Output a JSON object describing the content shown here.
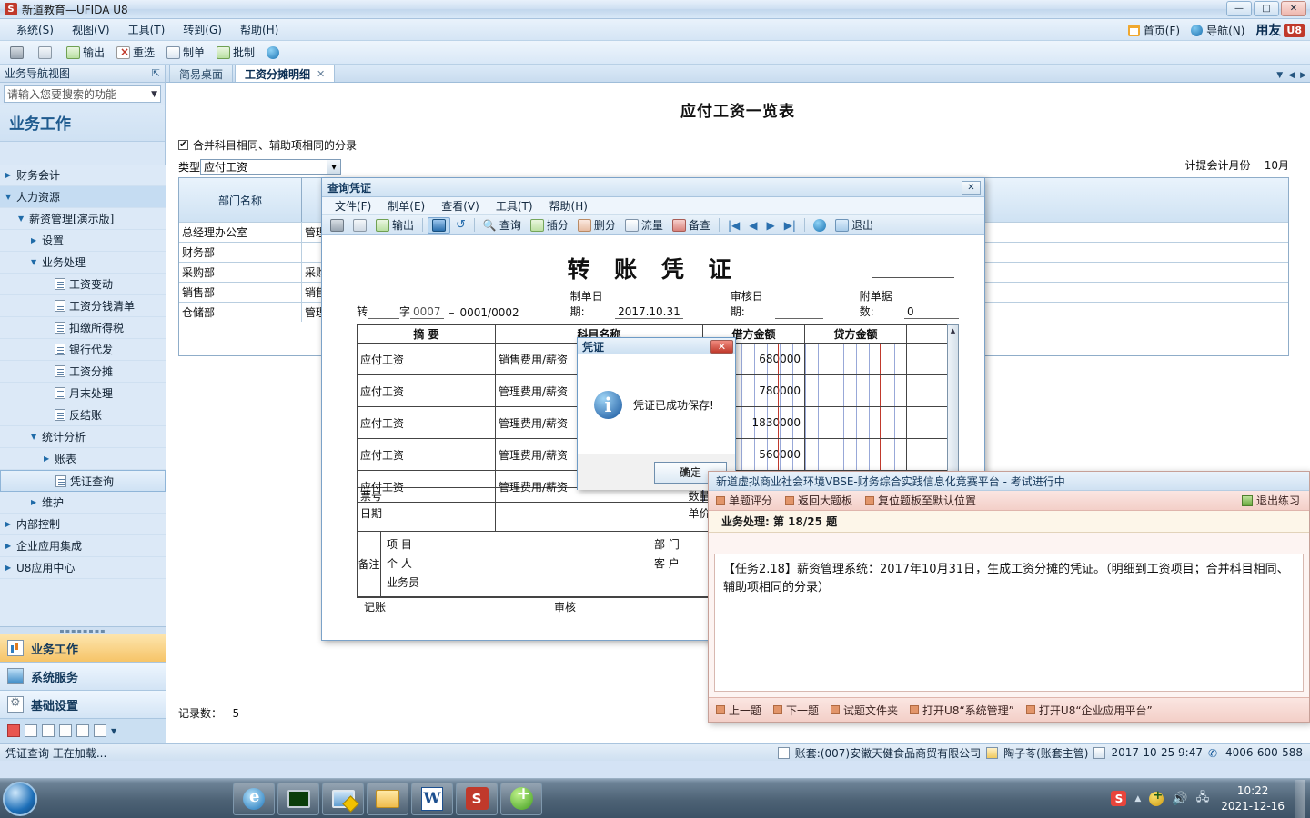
{
  "window": {
    "title": "新道教育—UFIDA U8",
    "logo_text": "S",
    "buttons": {
      "minimize": "—",
      "maximize": "□",
      "close": "✕"
    }
  },
  "menubar": {
    "items": [
      "系统(S)",
      "视图(V)",
      "工具(T)",
      "转到(G)",
      "帮助(H)"
    ],
    "right": {
      "home": "首页(F)",
      "nav": "导航(N)",
      "brand": "用友",
      "brand_mark": "U8"
    }
  },
  "toolbar": {
    "items": [
      {
        "label": "",
        "icon": "print-icon"
      },
      {
        "label": "",
        "icon": "preview-icon"
      },
      {
        "label": "输出",
        "icon": "export-icon"
      },
      {
        "label": "重选",
        "icon": "reselect-icon"
      },
      {
        "label": "制单",
        "icon": "voucher-icon"
      },
      {
        "label": "批制",
        "icon": "batch-icon"
      },
      {
        "label": "",
        "icon": "help-icon"
      }
    ]
  },
  "sidebar": {
    "header": "业务导航视图",
    "pin": "⇱",
    "search_placeholder": "请输入您要搜索的功能",
    "title": "业务工作",
    "tree": [
      {
        "label": "财务会计",
        "indent": 0,
        "arrow": "right",
        "type": "folder"
      },
      {
        "label": "人力资源",
        "indent": 0,
        "arrow": "down",
        "type": "folder",
        "highlight": true
      },
      {
        "label": "薪资管理[演示版]",
        "indent": 1,
        "arrow": "down",
        "type": "folder"
      },
      {
        "label": "设置",
        "indent": 2,
        "arrow": "right",
        "type": "folder"
      },
      {
        "label": "业务处理",
        "indent": 2,
        "arrow": "down",
        "type": "folder"
      },
      {
        "label": "工资变动",
        "indent": 3,
        "arrow": "none",
        "type": "doc"
      },
      {
        "label": "工资分钱清单",
        "indent": 3,
        "arrow": "none",
        "type": "doc"
      },
      {
        "label": "扣缴所得税",
        "indent": 3,
        "arrow": "none",
        "type": "doc"
      },
      {
        "label": "银行代发",
        "indent": 3,
        "arrow": "none",
        "type": "doc"
      },
      {
        "label": "工资分摊",
        "indent": 3,
        "arrow": "none",
        "type": "doc"
      },
      {
        "label": "月末处理",
        "indent": 3,
        "arrow": "none",
        "type": "doc"
      },
      {
        "label": "反结账",
        "indent": 3,
        "arrow": "none",
        "type": "doc"
      },
      {
        "label": "统计分析",
        "indent": 2,
        "arrow": "down",
        "type": "folder"
      },
      {
        "label": "账表",
        "indent": 3,
        "arrow": "right",
        "type": "folder"
      },
      {
        "label": "凭证查询",
        "indent": 3,
        "arrow": "none",
        "type": "doc",
        "selected": true
      },
      {
        "label": "维护",
        "indent": 2,
        "arrow": "right",
        "type": "folder"
      },
      {
        "label": "内部控制",
        "indent": 0,
        "arrow": "right",
        "type": "folder"
      },
      {
        "label": "企业应用集成",
        "indent": 0,
        "arrow": "right",
        "type": "folder"
      },
      {
        "label": "U8应用中心",
        "indent": 0,
        "arrow": "right",
        "type": "folder"
      }
    ],
    "bottom_buttons": [
      {
        "label": "业务工作",
        "icon": "chart-icon",
        "active": true
      },
      {
        "label": "系统服务",
        "icon": "monitor-icon",
        "active": false
      },
      {
        "label": "基础设置",
        "icon": "gear-icon",
        "active": false
      }
    ]
  },
  "tabs": [
    {
      "label": "简易桌面",
      "active": false,
      "closable": false
    },
    {
      "label": "工资分摊明细",
      "active": true,
      "closable": true,
      "close": "✕"
    }
  ],
  "report": {
    "title": "应付工资一览表",
    "merge_checkbox_label": "合并科目相同、辅助项相同的分录",
    "merge_checked": true,
    "type_label": "类型",
    "type_value": "应付工资",
    "period_label": "计提会计月份",
    "period_value": "10月",
    "columns": [
      "部门名称",
      "",
      "",
      ""
    ],
    "rows": [
      {
        "dept": "总经理办公室",
        "c2": "管理人",
        "c3": "",
        "c4": ""
      },
      {
        "dept": "财务部",
        "c2": "",
        "c3": "",
        "c4": ""
      },
      {
        "dept": "采购部",
        "c2": "采购人",
        "c3": "",
        "c4": ""
      },
      {
        "dept": "销售部",
        "c2": "销售人",
        "c3": "",
        "c4": ""
      },
      {
        "dept": "仓储部",
        "c2": "管理人",
        "c3": "",
        "c4": ""
      }
    ],
    "record_count_label": "记录数：",
    "record_count_value": "5"
  },
  "voucher_window": {
    "title": "查询凭证",
    "close": "✕",
    "menu": [
      "文件(F)",
      "制单(E)",
      "查看(V)",
      "工具(T)",
      "帮助(H)"
    ],
    "toolbar": [
      {
        "label": "",
        "icon": "print-icon"
      },
      {
        "label": "",
        "icon": "preview-icon"
      },
      {
        "label": "输出",
        "icon": "export-icon"
      },
      {
        "label": "",
        "icon": "save-icon",
        "active": true
      },
      {
        "label": "",
        "icon": "undo-icon"
      },
      {
        "label": "查询",
        "icon": "search-icon"
      },
      {
        "label": "插分",
        "icon": "insert-split-icon"
      },
      {
        "label": "删分",
        "icon": "delete-split-icon"
      },
      {
        "label": "流量",
        "icon": "flow-icon"
      },
      {
        "label": "备查",
        "icon": "memo-icon"
      },
      {
        "label": "",
        "icon": "first-icon"
      },
      {
        "label": "",
        "icon": "prev-icon"
      },
      {
        "label": "",
        "icon": "next-icon"
      },
      {
        "label": "",
        "icon": "last-icon"
      },
      {
        "label": "",
        "icon": "help-icon"
      },
      {
        "label": "退出",
        "icon": "exit-icon"
      }
    ],
    "doc_title": "转 账 凭 证",
    "header": {
      "word_prefix": "转",
      "word_label": "字",
      "number": "0007",
      "dash": "–",
      "page": "0001/0002",
      "make_date_label": "制单日期:",
      "make_date": "2017.10.31",
      "audit_date_label": "审核日期:",
      "audit_date": "",
      "attach_label": "附单据数:",
      "attach_value": "0"
    },
    "grid_columns": [
      "摘 要",
      "科目名称",
      "借方金额",
      "贷方金额"
    ],
    "grid_rows": [
      {
        "summary": "应付工资",
        "subject": "销售费用/薪资",
        "debit": "680000",
        "credit": ""
      },
      {
        "summary": "应付工资",
        "subject": "管理费用/薪资",
        "debit": "780000",
        "credit": ""
      },
      {
        "summary": "应付工资",
        "subject": "管理费用/薪资",
        "debit": "1830000",
        "credit": ""
      },
      {
        "summary": "应付工资",
        "subject": "管理费用/薪资",
        "debit": "560000",
        "credit": ""
      },
      {
        "summary": "应付工资",
        "subject": "管理费用/薪资",
        "debit": "",
        "credit": ""
      }
    ],
    "summary": {
      "bill_no_label": "票号",
      "date_label": "日期",
      "qty_label": "数量",
      "price_label": "单价"
    },
    "note": {
      "note_label": "备注",
      "project_label": "项 目",
      "person_label": "个 人",
      "clerk_label": "业务员",
      "dept_label": "部 门",
      "customer_label": "客 户"
    },
    "footer": {
      "bookkeeper_label": "记账",
      "auditor_label": "审核"
    }
  },
  "msgbox": {
    "title": "凭证",
    "close": "✕",
    "icon": "info-icon",
    "message": "凭证已成功保存!",
    "ok_label": "确定"
  },
  "vbse": {
    "title": "新道虚拟商业社会环境VBSE-财务综合实践信息化竞赛平台 - 考试进行中",
    "toolbar": [
      "单题评分",
      "返回大题板",
      "复位题板至默认位置"
    ],
    "exit_label": "退出练习",
    "question_label": "业务处理:",
    "question_progress": "第 18/25 题",
    "task_text": "【任务2.18】薪资管理系统：2017年10月31日，生成工资分摊的凭证。（明细到工资项目；合并科目相同、辅助项相同的分录）",
    "footer": [
      "上一题",
      "下一题",
      "试题文件夹",
      "打开U8“系统管理”",
      "打开U8“企业应用平台”"
    ]
  },
  "statusbar": {
    "left": "凭证查询 正在加载...",
    "account_set": "账套:(007)安徽天健食品商贸有限公司",
    "user": "陶子苓(账套主管)",
    "date": "2017-10-25 9:47",
    "phone": "4006-600-588"
  },
  "taskbar": {
    "items": [
      "ie-icon",
      "terminal-icon",
      "monitor-icon",
      "folder-icon",
      "word-icon",
      "u8-icon",
      "green-plus-icon"
    ],
    "tray": [
      "sogou-icon",
      "arrow-up-icon",
      "shield-icon",
      "volume-icon",
      "network-icon"
    ],
    "time": "10:22",
    "date": "2021-12-16"
  }
}
